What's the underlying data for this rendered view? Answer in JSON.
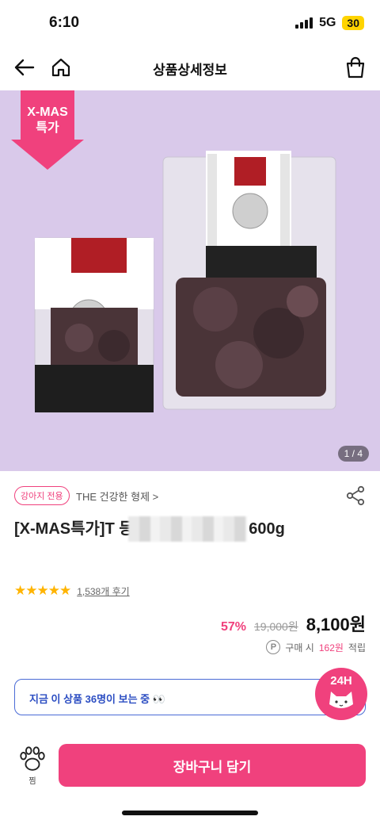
{
  "status_bar": {
    "time": "6:10",
    "network": "5G",
    "battery": "30"
  },
  "header": {
    "title": "상품상세정보"
  },
  "product_image": {
    "promo_line1": "X-MAS",
    "promo_line2": "특가",
    "counter": "1 / 4",
    "background_color": "#d9c9ea"
  },
  "brand": {
    "category_badge": "강아지 전용",
    "brand_name": "THE 건강한 형제 >"
  },
  "product": {
    "title": "[X-MAS특가]T                        등 수제간식 양등뼈 600g",
    "rating_stars": "★★★★★",
    "review_count": "1,538개 후기"
  },
  "price": {
    "discount": "57%",
    "original": "19,000원",
    "sale": "8,100원"
  },
  "points": {
    "icon_letter": "P",
    "prefix": "구매 시",
    "value": "162원",
    "suffix": "적립"
  },
  "viewers": {
    "text": "지금 이 상품 36명이 보는 중 👀",
    "badge": "24H"
  },
  "bottom_bar": {
    "wish_label": "찜",
    "cart_label": "장바구니 담기"
  },
  "colors": {
    "accent": "#f0417d",
    "blue": "#2b4dc2",
    "star": "#ffb400"
  }
}
